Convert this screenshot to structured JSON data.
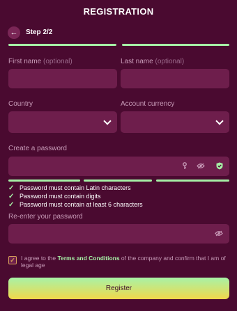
{
  "header": {
    "title": "REGISTRATION",
    "step": "Step 2/2",
    "back_icon": "arrow-left-icon"
  },
  "form": {
    "first_name": {
      "label": "First name",
      "optional": "(optional)",
      "value": ""
    },
    "last_name": {
      "label": "Last name",
      "optional": "(optional)",
      "value": ""
    },
    "country": {
      "label": "Country",
      "value": ""
    },
    "currency": {
      "label": "Account currency",
      "value": ""
    },
    "password": {
      "label": "Create a password",
      "value": ""
    },
    "rules": [
      "Password must contain Latin characters",
      "Password must contain digits",
      "Password must contain at least 6 characters"
    ],
    "repeat_password": {
      "label": "Re-enter your password",
      "value": ""
    },
    "agree": {
      "prefix": "I agree to the ",
      "link": "Terms and Conditions",
      "suffix": " of the company and confirm that I am of legal age",
      "checked": true
    },
    "register_label": "Register"
  },
  "colors": {
    "background": "#4a0a30",
    "field": "#6e1e4c",
    "accent": "#a6f0a6",
    "cta_bottom": "#f2d84a"
  }
}
